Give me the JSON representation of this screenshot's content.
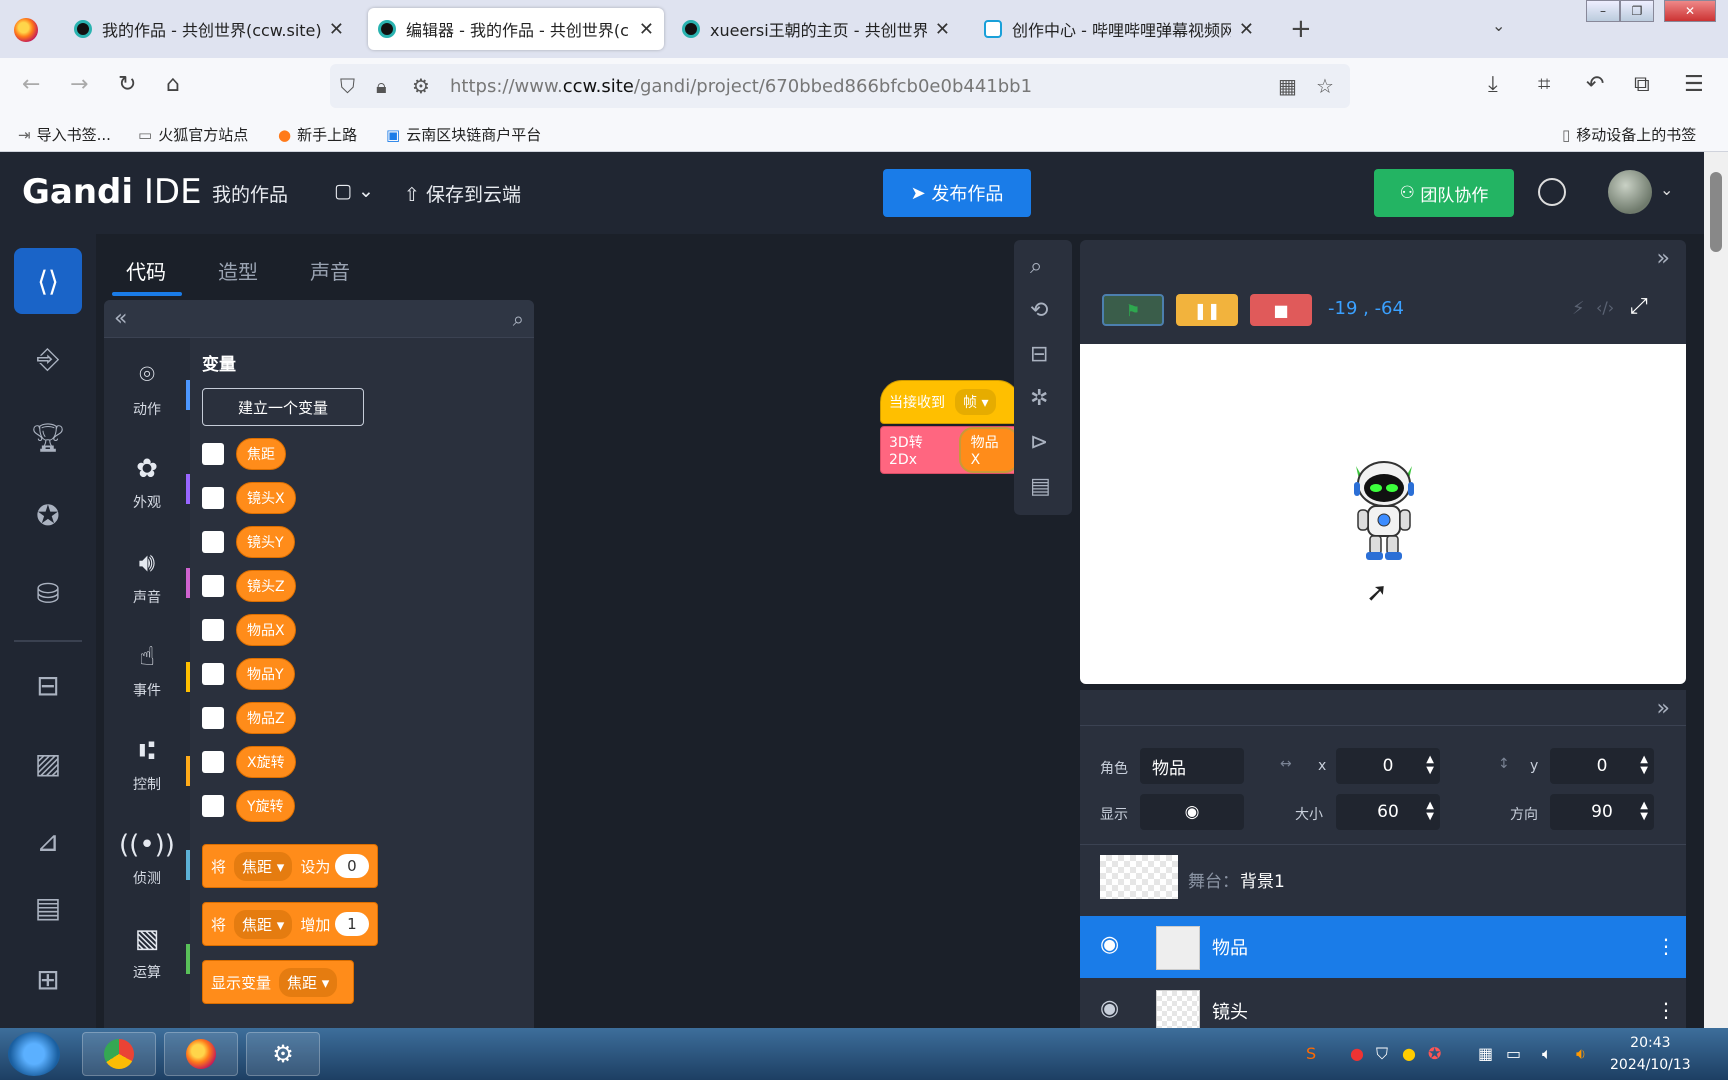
{
  "browser": {
    "tabs": [
      {
        "title": "我的作品 - 共创世界(ccw.site)",
        "active": false,
        "favicon": "ccw-icon"
      },
      {
        "title": "编辑器 - 我的作品 - 共创世界(c",
        "active": true,
        "favicon": "ccw-icon"
      },
      {
        "title": "xueersi王朝的主页 - 共创世界(",
        "active": false,
        "favicon": "ccw-icon"
      },
      {
        "title": "创作中心 - 哔哩哔哩弹幕视频网",
        "active": false,
        "favicon": "bilibili-icon"
      }
    ],
    "url_prefix": "https://www.",
    "url_domain": "ccw.site",
    "url_path": "/gandi/project/670bbed866bfcb0e0b441bb1",
    "bookmarks": [
      "导入书签...",
      "火狐官方站点",
      "新手上路",
      "云南区块链商户平台"
    ],
    "mobile_bookmarks": "移动设备上的书签"
  },
  "app": {
    "brand_bold": "Gandi",
    "brand_light": " IDE",
    "my_works": "我的作品",
    "save_cloud": "保存到云端",
    "publish": "发布作品",
    "team": "团队协作"
  },
  "editor": {
    "tabs": [
      "代码",
      "造型",
      "声音"
    ],
    "categories": [
      {
        "label": "动作",
        "color": "#4c97ff"
      },
      {
        "label": "外观",
        "color": "#9966ff"
      },
      {
        "label": "声音",
        "color": "#cf63cf"
      },
      {
        "label": "事件",
        "color": "#ffbf00"
      },
      {
        "label": "控制",
        "color": "#ffab19"
      },
      {
        "label": "侦测",
        "color": "#5cb1d6"
      },
      {
        "label": "运算",
        "color": "#59c059"
      }
    ],
    "section_title": "变量",
    "make_variable": "建立一个变量",
    "variables": [
      "焦距",
      "镜头X",
      "镜头Y",
      "镜头Z",
      "物品X",
      "物品Y",
      "物品Z",
      "X旋转",
      "Y旋转"
    ],
    "block_set": {
      "word": "将",
      "var": "焦距",
      "action": "设为",
      "value": "0"
    },
    "block_change": {
      "word": "将",
      "var": "焦距",
      "action": "增加",
      "value": "1"
    },
    "block_show": {
      "word": "显示变量",
      "var": "焦距"
    },
    "canvas_hat": {
      "label": "当接收到",
      "dd": "帧"
    },
    "canvas_block": {
      "label": "3D转2Dx",
      "arg": "物品X"
    }
  },
  "stage": {
    "coords": "-19 , -64"
  },
  "sprite_info": {
    "role_label": "角色",
    "role_value": "物品",
    "x_label": "x",
    "x_value": "0",
    "y_label": "y",
    "y_value": "0",
    "show_label": "显示",
    "size_label": "大小",
    "size_value": "60",
    "dir_label": "方向",
    "dir_value": "90",
    "stage_label": "舞台：",
    "stage_bg": "背景1",
    "sprites": [
      {
        "name": "物品",
        "selected": true
      },
      {
        "name": "镜头",
        "selected": false
      }
    ]
  },
  "taskbar": {
    "time": "20:43",
    "date": "2024/10/13"
  }
}
